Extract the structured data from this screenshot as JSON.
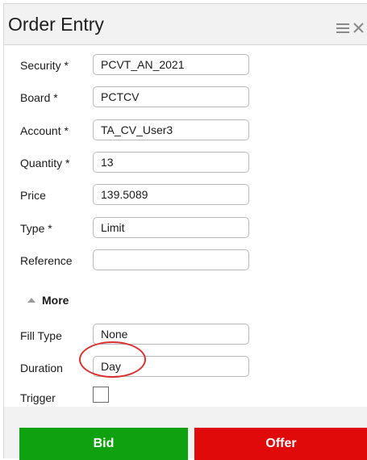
{
  "window": {
    "title": "Order Entry",
    "menu_icon": "hamburger-menu-icon",
    "close_icon": "close-icon"
  },
  "form": {
    "security": {
      "label": "Security *",
      "value": "PCVT_AN_2021"
    },
    "board": {
      "label": "Board *",
      "value": "PCTCV"
    },
    "account": {
      "label": "Account *",
      "value": "TA_CV_User3"
    },
    "quantity": {
      "label": "Quantity *",
      "value": "13"
    },
    "price": {
      "label": "Price",
      "value": "139.5089"
    },
    "type": {
      "label": "Type *",
      "value": "Limit"
    },
    "reference": {
      "label": "Reference",
      "value": ""
    }
  },
  "more": {
    "label": "More",
    "icon": "caret-up-icon",
    "fill_type": {
      "label": "Fill Type",
      "value": "None"
    },
    "duration": {
      "label": "Duration",
      "value": "Day"
    },
    "trigger": {
      "label": "Trigger",
      "checked": false
    }
  },
  "actions": {
    "bid_label": "Bid",
    "offer_label": "Offer"
  },
  "colors": {
    "bid": "#10a110",
    "offer": "#e10a0a",
    "highlight": "#d9312f"
  }
}
